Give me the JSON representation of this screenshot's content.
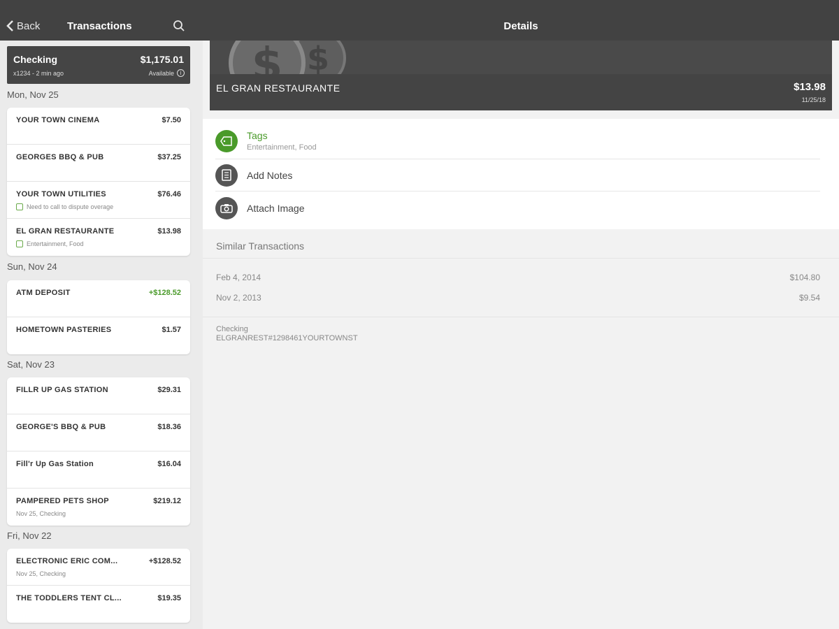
{
  "topbar": {
    "back_label": "Back",
    "left_title": "Transactions",
    "right_title": "Details"
  },
  "account": {
    "name": "Checking",
    "sub": "x1234 - 2 min ago",
    "balance": "$1,175.01",
    "available_label": "Available"
  },
  "days": [
    {
      "label": "Mon, Nov 25",
      "transactions": [
        {
          "name": "YOUR TOWN CINEMA",
          "amount": "$7.50",
          "sub": ""
        },
        {
          "name": "GEORGES BBQ & PUB",
          "amount": "$37.25",
          "sub": ""
        },
        {
          "name": "YOUR TOWN UTILITIES",
          "amount": "$76.46",
          "sub": "Need to call to dispute overage"
        },
        {
          "name": "EL GRAN RESTAURANTE",
          "amount": "$13.98",
          "sub": "Entertainment, Food"
        }
      ]
    },
    {
      "label": "Sun, Nov 24",
      "transactions": [
        {
          "name": "ATM DEPOSIT",
          "amount": "+$128.52",
          "sub": ""
        },
        {
          "name": "HOMETOWN PASTERIES",
          "amount": "$1.57",
          "sub": ""
        }
      ]
    },
    {
      "label": "Sat, Nov 23",
      "transactions": [
        {
          "name": "FILLR UP GAS STATION",
          "amount": "$29.31",
          "sub": ""
        },
        {
          "name": "GEORGE'S BBQ & PUB",
          "amount": "$18.36",
          "sub": ""
        },
        {
          "name": "Fill'r Up Gas Station",
          "amount": "$16.04",
          "sub": ""
        },
        {
          "name": "PAMPERED PETS SHOP",
          "amount": "$219.12",
          "sub": "Nov 25, Checking"
        }
      ]
    },
    {
      "label": "Fri, Nov 22",
      "transactions": [
        {
          "name": "ELECTRONIC ERIC COM...",
          "amount": "+$128.52",
          "sub": "Nov 25, Checking"
        },
        {
          "name": "THE TODDLERS TENT CL...",
          "amount": "$19.35",
          "sub": ""
        }
      ]
    }
  ],
  "detail": {
    "merchant": "EL GRAN RESTAURANTE",
    "amount": "$13.98",
    "date": "11/25/18",
    "tags_label": "Tags",
    "tags_value": "Entertainment, Food",
    "notes_label": "Add Notes",
    "image_label": "Attach Image",
    "similar_title": "Similar Transactions",
    "similar": [
      {
        "date": "Feb 4, 2014",
        "amount": "$104.80"
      },
      {
        "date": "Nov 2, 2013",
        "amount": "$9.54"
      }
    ],
    "account_name": "Checking",
    "raw_desc": "ELGRANREST#1298461YOURTOWNST"
  },
  "colors": {
    "accent_green": "#4a9a2a",
    "header_dark": "#424242"
  }
}
